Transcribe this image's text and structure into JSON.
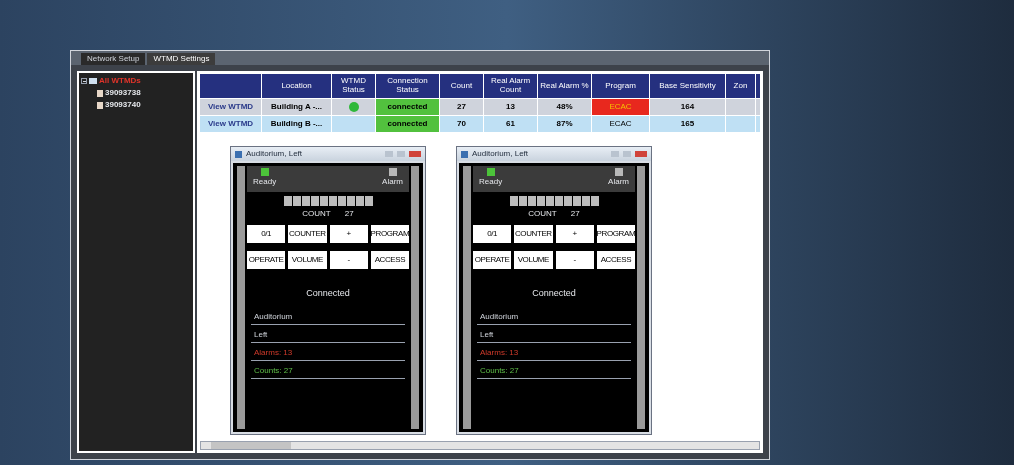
{
  "tabs": [
    {
      "label": "Network Setup",
      "selected": false
    },
    {
      "label": "WTMD Settings",
      "selected": true
    }
  ],
  "tree": {
    "label": "All WTMDs",
    "expanded": true,
    "children": [
      {
        "label": "39093738"
      },
      {
        "label": "39093740"
      }
    ]
  },
  "table": {
    "columns": [
      "",
      "Location",
      "WTMD Status",
      "Connection Status",
      "Count",
      "Real Alarm Count",
      "Real Alarm %",
      "Program",
      "Base Sensitivity",
      "Zon"
    ],
    "rows": [
      {
        "link": "View WTMD",
        "location": "Building A -...",
        "status_on": true,
        "connection": "connected",
        "count": "27",
        "alarm_count": "13",
        "alarm_pct": "48%",
        "program": "ECAC",
        "program_alarm": true,
        "sensitivity": "164"
      },
      {
        "link": "View WTMD",
        "location": "Building B -...",
        "status_on": false,
        "connection": "connected",
        "count": "70",
        "alarm_count": "61",
        "alarm_pct": "87%",
        "program": "ECAC",
        "program_alarm": false,
        "sensitivity": "165"
      }
    ]
  },
  "panels": [
    {
      "title": "Auditorium, Left",
      "ready": true,
      "alarm": false,
      "ready_label": "Ready",
      "alarm_label": "Alarm",
      "count_label": "COUNT",
      "count": "27",
      "buttons": [
        "0/1",
        "COUNTER",
        "+",
        "PROGRAM",
        "OPERATE",
        "VOLUME",
        "-",
        "ACCESS"
      ],
      "status": "Connected",
      "fields": [
        {
          "kind": "plain",
          "text": "Auditorium"
        },
        {
          "kind": "plain",
          "text": "Left"
        },
        {
          "kind": "alarm",
          "text": "Alarms: 13"
        },
        {
          "kind": "count",
          "text": "Counts: 27"
        }
      ]
    },
    {
      "title": "Auditorium, Left",
      "ready": true,
      "alarm": false,
      "ready_label": "Ready",
      "alarm_label": "Alarm",
      "count_label": "COUNT",
      "count": "27",
      "buttons": [
        "0/1",
        "COUNTER",
        "+",
        "PROGRAM",
        "OPERATE",
        "VOLUME",
        "-",
        "ACCESS"
      ],
      "status": "Connected",
      "fields": [
        {
          "kind": "plain",
          "text": "Auditorium"
        },
        {
          "kind": "plain",
          "text": "Left"
        },
        {
          "kind": "alarm",
          "text": "Alarms: 13"
        },
        {
          "kind": "count",
          "text": "Counts: 27"
        }
      ]
    }
  ]
}
